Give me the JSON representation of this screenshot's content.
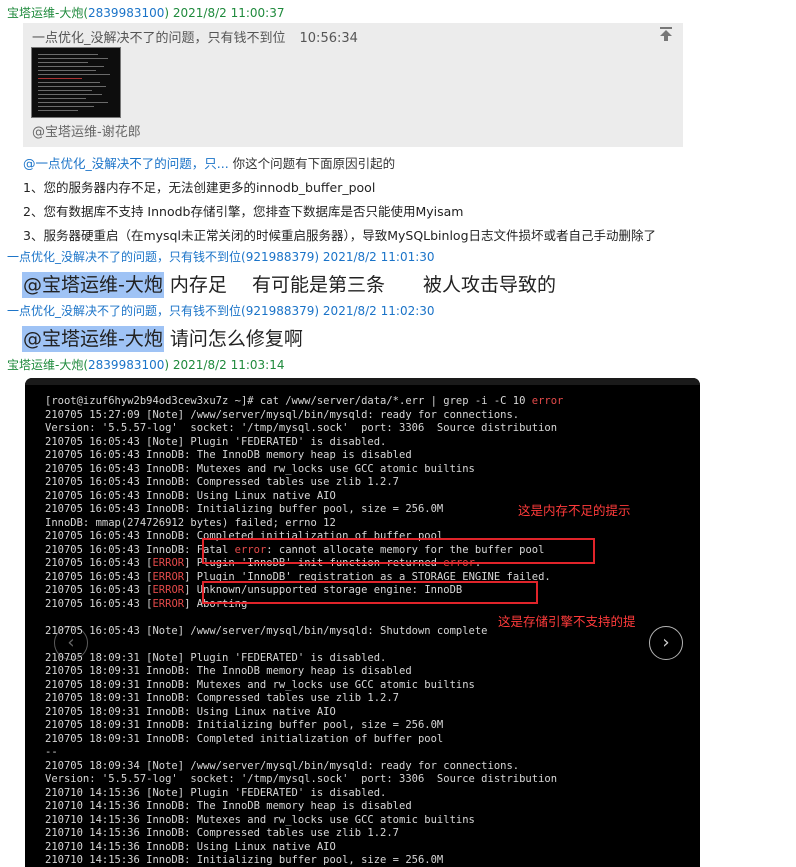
{
  "messages": [
    {
      "sender": "宝塔运维-大炮",
      "qq": "2839983100",
      "time": "2021/8/2 11:00:37"
    },
    {
      "sender": "一点优化_没解决不了的问题，只有钱不到位",
      "qq": "921988379",
      "time": "2021/8/2 11:01:30"
    },
    {
      "sender": "一点优化_没解决不了的问题，只有钱不到位",
      "qq": "921988379",
      "time": "2021/8/2 11:02:30"
    },
    {
      "sender": "宝塔运维-大炮",
      "qq": "2839983100",
      "time": "2021/8/2 11:03:14"
    }
  ],
  "quote": {
    "text": "一点优化_没解决不了的问题，只有钱不到位",
    "time": "10:56:34",
    "author": "@宝塔运维-谢花郎"
  },
  "reply": {
    "ref": "@一点优化_没解决不了的问题，只...",
    "text": "你这个问题有下面原因引起的"
  },
  "reasons": [
    "1、您的服务器内存不足，无法创建更多的innodb_buffer_pool",
    "2、您有数据库不支持 Innodb存储引擎，您排查下数据库是否只能使用Myisam",
    "3、服务器硬重启（在mysql未正常关闭的时候重启服务器），导致MySQLbinlog日志文件损坏或者自己手动删除了"
  ],
  "msg2": {
    "mention": "@宝塔运维-大炮",
    "text": "内存足　 有可能是第三条　　被人攻击导致的"
  },
  "msg3": {
    "mention": "@宝塔运维-大炮",
    "text": "请问怎么修复啊"
  },
  "annotations": {
    "note1": "这是内存不足的提示",
    "note2": "这是存储引擎不支持的提"
  },
  "terminal": {
    "lines": [
      "[root@izuf6hyw2b94od3cew3xu7z ~]# cat /www/server/data/*.err | grep -i -C 10 error",
      "210705 15:27:09 [Note] /www/server/mysql/bin/mysqld: ready for connections.",
      "Version: '5.5.57-log'  socket: '/tmp/mysql.sock'  port: 3306  Source distribution",
      "210705 16:05:43 [Note] Plugin 'FEDERATED' is disabled.",
      "210705 16:05:43 InnoDB: The InnoDB memory heap is disabled",
      "210705 16:05:43 InnoDB: Mutexes and rw_locks use GCC atomic builtins",
      "210705 16:05:43 InnoDB: Compressed tables use zlib 1.2.7",
      "210705 16:05:43 InnoDB: Using Linux native AIO",
      "210705 16:05:43 InnoDB: Initializing buffer pool, size = 256.0M",
      "InnoDB: mmap(274726912 bytes) failed; errno 12",
      "210705 16:05:43 InnoDB: Completed initialization of buffer pool",
      "210705 16:05:43 InnoDB: Fatal error: cannot allocate memory for the buffer pool",
      "210705 16:05:43 [ERROR] Plugin 'InnoDB' init function returned error.",
      "210705 16:05:43 [ERROR] Plugin 'InnoDB' registration as a STORAGE ENGINE failed.",
      "210705 16:05:43 [ERROR] Unknown/unsupported storage engine: InnoDB",
      "210705 16:05:43 [ERROR] Aborting",
      "",
      "210705 16:05:43 [Note] /www/server/mysql/bin/mysqld: Shutdown complete",
      "",
      "210705 18:09:31 [Note] Plugin 'FEDERATED' is disabled.",
      "210705 18:09:31 InnoDB: The InnoDB memory heap is disabled",
      "210705 18:09:31 InnoDB: Mutexes and rw_locks use GCC atomic builtins",
      "210705 18:09:31 InnoDB: Compressed tables use zlib 1.2.7",
      "210705 18:09:31 InnoDB: Using Linux native AIO",
      "210705 18:09:31 InnoDB: Initializing buffer pool, size = 256.0M",
      "210705 18:09:31 InnoDB: Completed initialization of buffer pool",
      "--",
      "210705 18:09:34 [Note] /www/server/mysql/bin/mysqld: ready for connections.",
      "Version: '5.5.57-log'  socket: '/tmp/mysql.sock'  port: 3306  Source distribution",
      "210710 14:15:36 [Note] Plugin 'FEDERATED' is disabled.",
      "210710 14:15:36 InnoDB: The InnoDB memory heap is disabled",
      "210710 14:15:36 InnoDB: Mutexes and rw_locks use GCC atomic builtins",
      "210710 14:15:36 InnoDB: Compressed tables use zlib 1.2.7",
      "210710 14:15:36 InnoDB: Using Linux native AIO",
      "210710 14:15:36 InnoDB: Initializing buffer pool, size = 256.0M"
    ]
  },
  "colors": {
    "sender_green": "#1f8a3c",
    "link_blue": "#1a73c8",
    "mention_bg": "#9fc3f5",
    "error_red": "#e34a4a"
  }
}
